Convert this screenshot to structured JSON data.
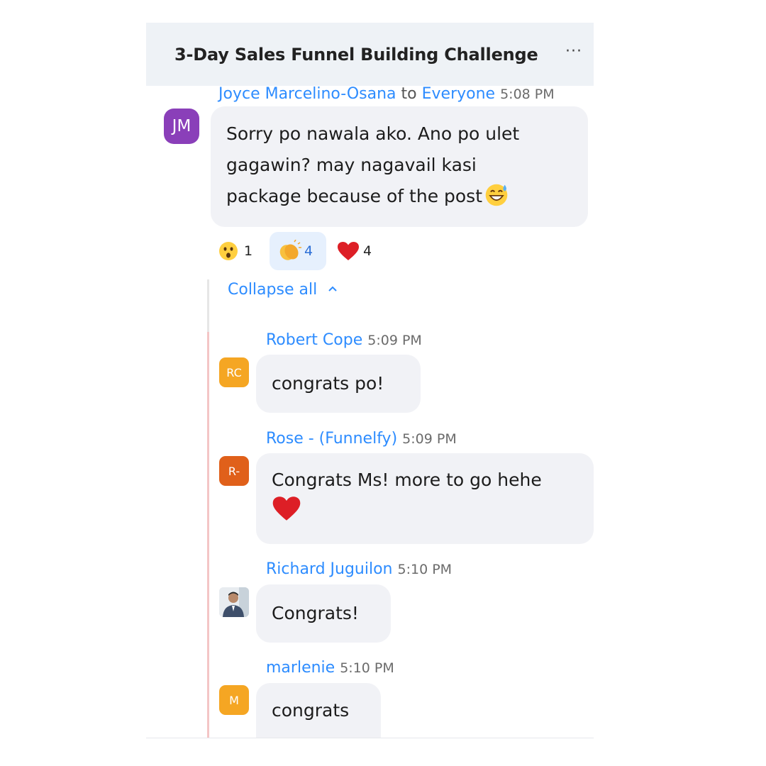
{
  "header": {
    "title": "3-Day Sales Funnel Building Challenge",
    "more_label": "···"
  },
  "main_message": {
    "sender": "Joyce Marcelino-Osana",
    "to_word": "to",
    "recipient": "Everyone",
    "time": "5:08 PM",
    "avatar_initials": "JM",
    "avatar_color": "#8a3fb9",
    "lines": [
      "Sorry po nawala ako. Ano po ulet",
      "gagawin? may nagavail kasi",
      "package because of the post"
    ],
    "trailing_emoji": "grinning-sweat-emoji"
  },
  "reactions": [
    {
      "emoji": "astonished-face",
      "count": "1",
      "selected": false
    },
    {
      "emoji": "clapping-hands",
      "count": "4",
      "selected": true
    },
    {
      "emoji": "red-heart",
      "count": "4",
      "selected": false
    }
  ],
  "collapse": {
    "label": "Collapse all",
    "icon": "chevron-up-icon"
  },
  "replies": [
    {
      "sender": "Robert Cope",
      "time": "5:09 PM",
      "avatar_initials": "RC",
      "avatar_color": "#f5a623",
      "text": "congrats po!"
    },
    {
      "sender": "Rose - (Funnelfy)",
      "time": "5:09 PM",
      "avatar_initials": "R-",
      "avatar_color": "#e0601a",
      "text": "Congrats Ms! more to go hehe",
      "trailing_emoji": "red-heart"
    },
    {
      "sender": "Richard Juguilon",
      "time": "5:10 PM",
      "avatar_type": "photo",
      "text": "Congrats!"
    },
    {
      "sender": "marlenie",
      "time": "5:10 PM",
      "avatar_initials": "M",
      "avatar_color": "#f5a623",
      "text": "congrats"
    }
  ],
  "colors": {
    "accent": "#2d8cff",
    "header_bg": "#eef2f6",
    "bubble_bg": "#f1f2f6",
    "thread_line": "#f4c5c6",
    "selected_reaction_bg": "#e6f0fd"
  }
}
